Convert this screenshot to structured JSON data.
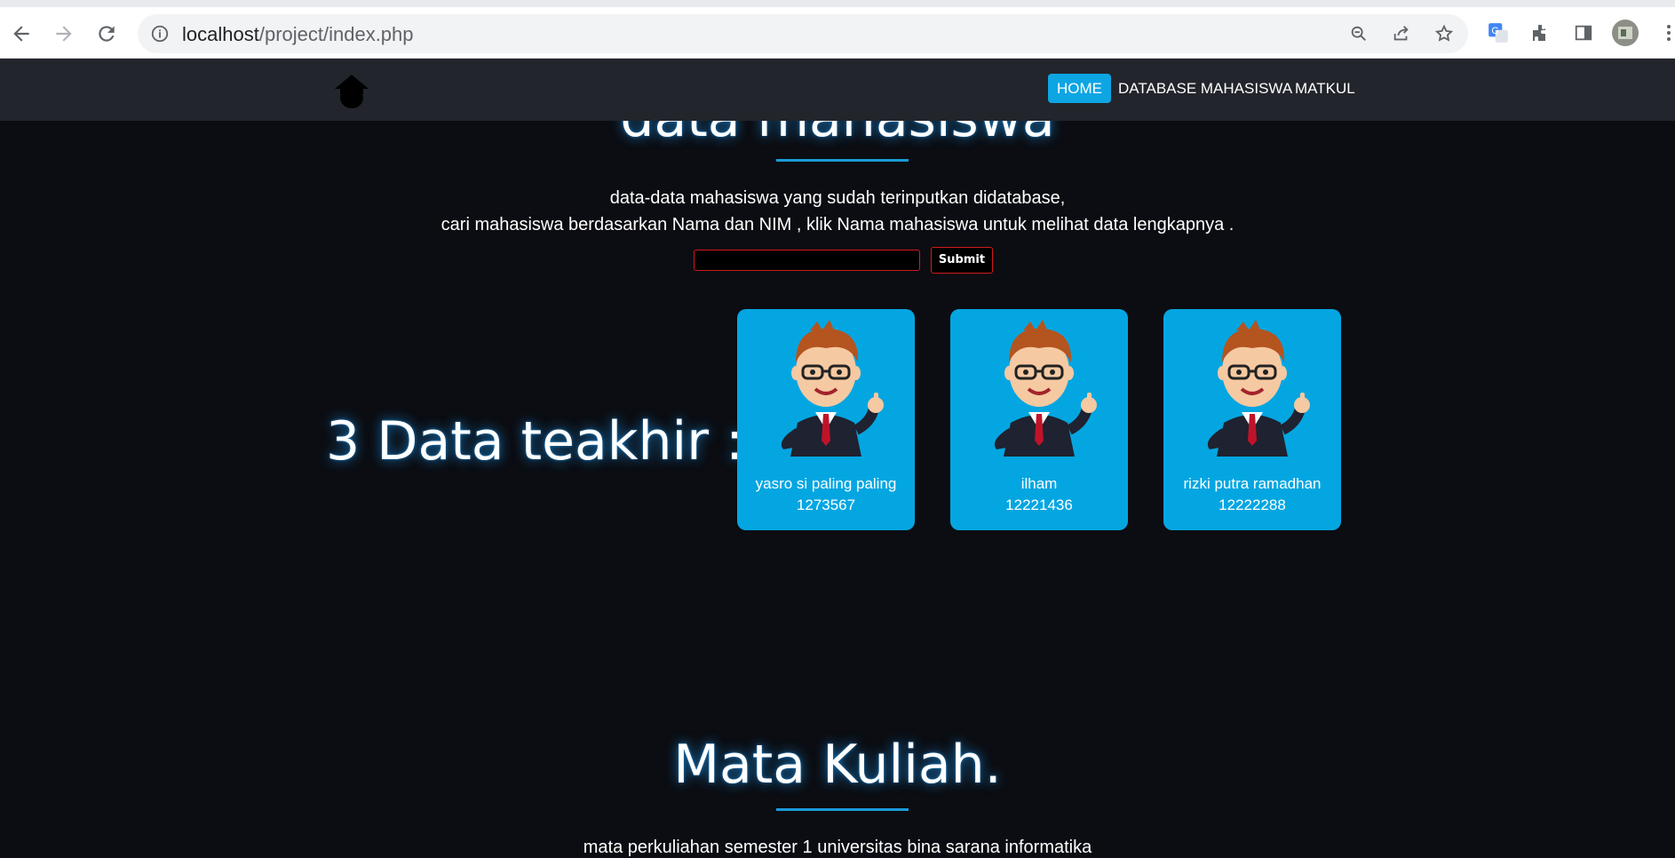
{
  "browser": {
    "url_host": "localhost",
    "url_path": "/project/index.php"
  },
  "navbar": {
    "items": [
      {
        "label": "HOME",
        "active": true
      },
      {
        "label": "DATABASE MAHASISWA",
        "active": false
      },
      {
        "label": "MATKUL",
        "active": false
      }
    ]
  },
  "hero": {
    "title": "data mahasiswa",
    "desc_line1": "data-data mahasiswa yang sudah terinputkan didatabase,",
    "desc_line2": "cari mahasiswa berdasarkan Nama dan NIM , klik Nama mahasiswa untuk melihat data lengkapnya .",
    "search_value": "",
    "submit_label": "Submit"
  },
  "latest": {
    "title": "3 Data teakhir :",
    "cards": [
      {
        "name": "yasro si paling paling",
        "nim": "1273567"
      },
      {
        "name": "ilham",
        "nim": "12221436"
      },
      {
        "name": "rizki putra ramadhan",
        "nim": "12222288"
      }
    ]
  },
  "matkul": {
    "title": "Mata Kuliah.",
    "desc": "mata perkuliahan semester 1 universitas bina sarana informatika"
  },
  "colors": {
    "accent": "#0ea5e3",
    "card": "#04a6e1",
    "navbar": "#22252b",
    "background": "#0b0d12",
    "submit_border": "#d21a1a"
  },
  "icons": [
    "back-icon",
    "forward-icon",
    "reload-icon",
    "info-icon",
    "zoom-icon",
    "share-icon",
    "star-icon",
    "translate-icon",
    "extensions-icon",
    "sidepanel-icon",
    "profile-icon",
    "menu-icon",
    "logo-icon",
    "avatar-illustration"
  ]
}
